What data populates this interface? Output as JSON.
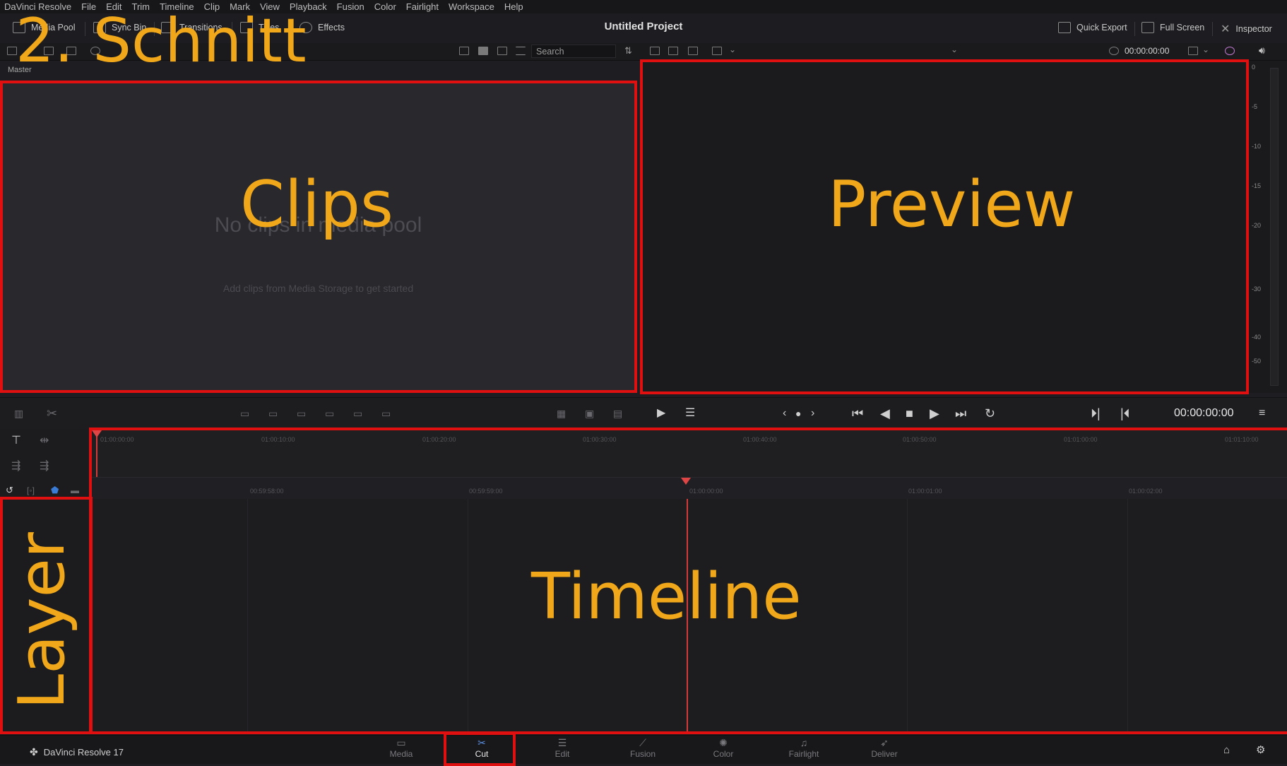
{
  "menu": [
    "DaVinci Resolve",
    "File",
    "Edit",
    "Trim",
    "Timeline",
    "Clip",
    "Mark",
    "View",
    "Playback",
    "Fusion",
    "Color",
    "Fairlight",
    "Workspace",
    "Help"
  ],
  "toolbar": {
    "media_pool": "Media Pool",
    "sync_bin": "Sync Bin",
    "transitions": "Transitions",
    "titles": "Titles",
    "effects": "Effects",
    "project_title": "Untitled Project",
    "quick_export": "Quick Export",
    "full_screen": "Full Screen",
    "inspector": "Inspector"
  },
  "search": {
    "placeholder": "Search"
  },
  "viewer": {
    "timecode_top": "00:00:00:00"
  },
  "media_pool": {
    "bin_label": "Master",
    "empty_title": "No clips in media pool",
    "empty_subtitle": "Add clips from Media Storage to get started"
  },
  "meter": {
    "ticks": [
      "0",
      "-5",
      "-10",
      "-15",
      "-20",
      "-30",
      "-40",
      "-50"
    ]
  },
  "transport": {
    "timecode": "00:00:00:00"
  },
  "timeline": {
    "upper_ruler": [
      "01:00:00:00",
      "01:00:10:00",
      "01:00:20:00",
      "01:00:30:00",
      "01:00:40:00",
      "01:00:50:00",
      "01:01:00:00",
      "01:01:10:00"
    ],
    "lower_ruler": [
      "00:59:58:00",
      "00:59:59:00",
      "01:00:00:00",
      "01:00:01:00",
      "01:00:02:00"
    ]
  },
  "bottom": {
    "brand": "DaVinci Resolve 17",
    "pages": [
      "Media",
      "Cut",
      "Edit",
      "Fusion",
      "Color",
      "Fairlight",
      "Deliver"
    ],
    "active_page": "Cut"
  },
  "annotations": {
    "heading": "2. Schnitt",
    "clips": "Clips",
    "preview": "Preview",
    "timeline": "Timeline",
    "layer": "Layer"
  },
  "colors": {
    "annotation_orange": "#f0a81a",
    "annotation_red": "#e01010",
    "playhead": "#d23b3b"
  }
}
